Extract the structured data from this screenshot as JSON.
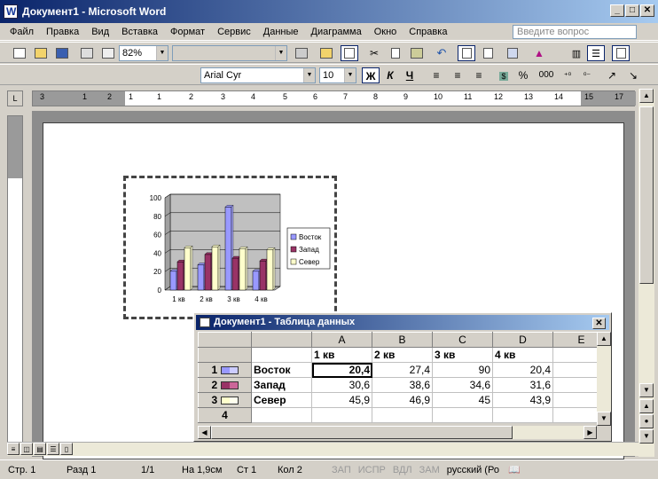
{
  "window": {
    "title": "Документ1 - Microsoft Word"
  },
  "menu": [
    "Файл",
    "Правка",
    "Вид",
    "Вставка",
    "Формат",
    "Сервис",
    "Данные",
    "Диаграмма",
    "Окно",
    "Справка"
  ],
  "help_placeholder": "Введите вопрос",
  "toolbar": {
    "zoom": "82%",
    "font": "Arial Cyr",
    "size": "10",
    "bold": "Ж",
    "italic": "К",
    "underline": "Ч",
    "percent": "%",
    "thousands": "000"
  },
  "ruler": {
    "h_marks": [
      "3",
      "1",
      "2",
      "1",
      "1",
      "2",
      "3",
      "4",
      "5",
      "6",
      "7",
      "8",
      "9",
      "10",
      "11",
      "12",
      "13",
      "14",
      "15",
      "17"
    ]
  },
  "datasheet": {
    "title": "Документ1 - Таблица данных",
    "columns": [
      "A",
      "B",
      "C",
      "D",
      "E"
    ],
    "header_row": [
      "1 кв",
      "2 кв",
      "3 кв",
      "4 кв",
      ""
    ],
    "rows": [
      {
        "num": "1",
        "label": "Восток",
        "values": [
          "20,4",
          "27,4",
          "90",
          "20,4"
        ]
      },
      {
        "num": "2",
        "label": "Запад",
        "values": [
          "30,6",
          "38,6",
          "34,6",
          "31,6"
        ]
      },
      {
        "num": "3",
        "label": "Север",
        "values": [
          "45,9",
          "46,9",
          "45",
          "43,9"
        ]
      },
      {
        "num": "4",
        "label": "",
        "values": [
          "",
          "",
          "",
          ""
        ]
      }
    ]
  },
  "chart_data": {
    "type": "bar",
    "categories": [
      "1 кв",
      "2 кв",
      "3 кв",
      "4 кв"
    ],
    "series": [
      {
        "name": "Восток",
        "values": [
          20.4,
          27.4,
          90,
          20.4
        ],
        "color": "#9999ff"
      },
      {
        "name": "Запад",
        "values": [
          30.6,
          38.6,
          34.6,
          31.6
        ],
        "color": "#993366"
      },
      {
        "name": "Север",
        "values": [
          45.9,
          46.9,
          45,
          43.9
        ],
        "color": "#ffffcc"
      }
    ],
    "ylim": [
      0,
      100
    ],
    "yticks": [
      "0",
      "20",
      "40",
      "60",
      "80",
      "100"
    ],
    "legend": "right",
    "grid": true
  },
  "status": [
    "Стр. 1",
    "Разд 1",
    "1/1",
    "На 1,9см",
    "Ст 1",
    "Кол 2",
    "ЗАП",
    "ИСПР",
    "ВДЛ",
    "ЗАМ",
    "русский (Ро"
  ]
}
